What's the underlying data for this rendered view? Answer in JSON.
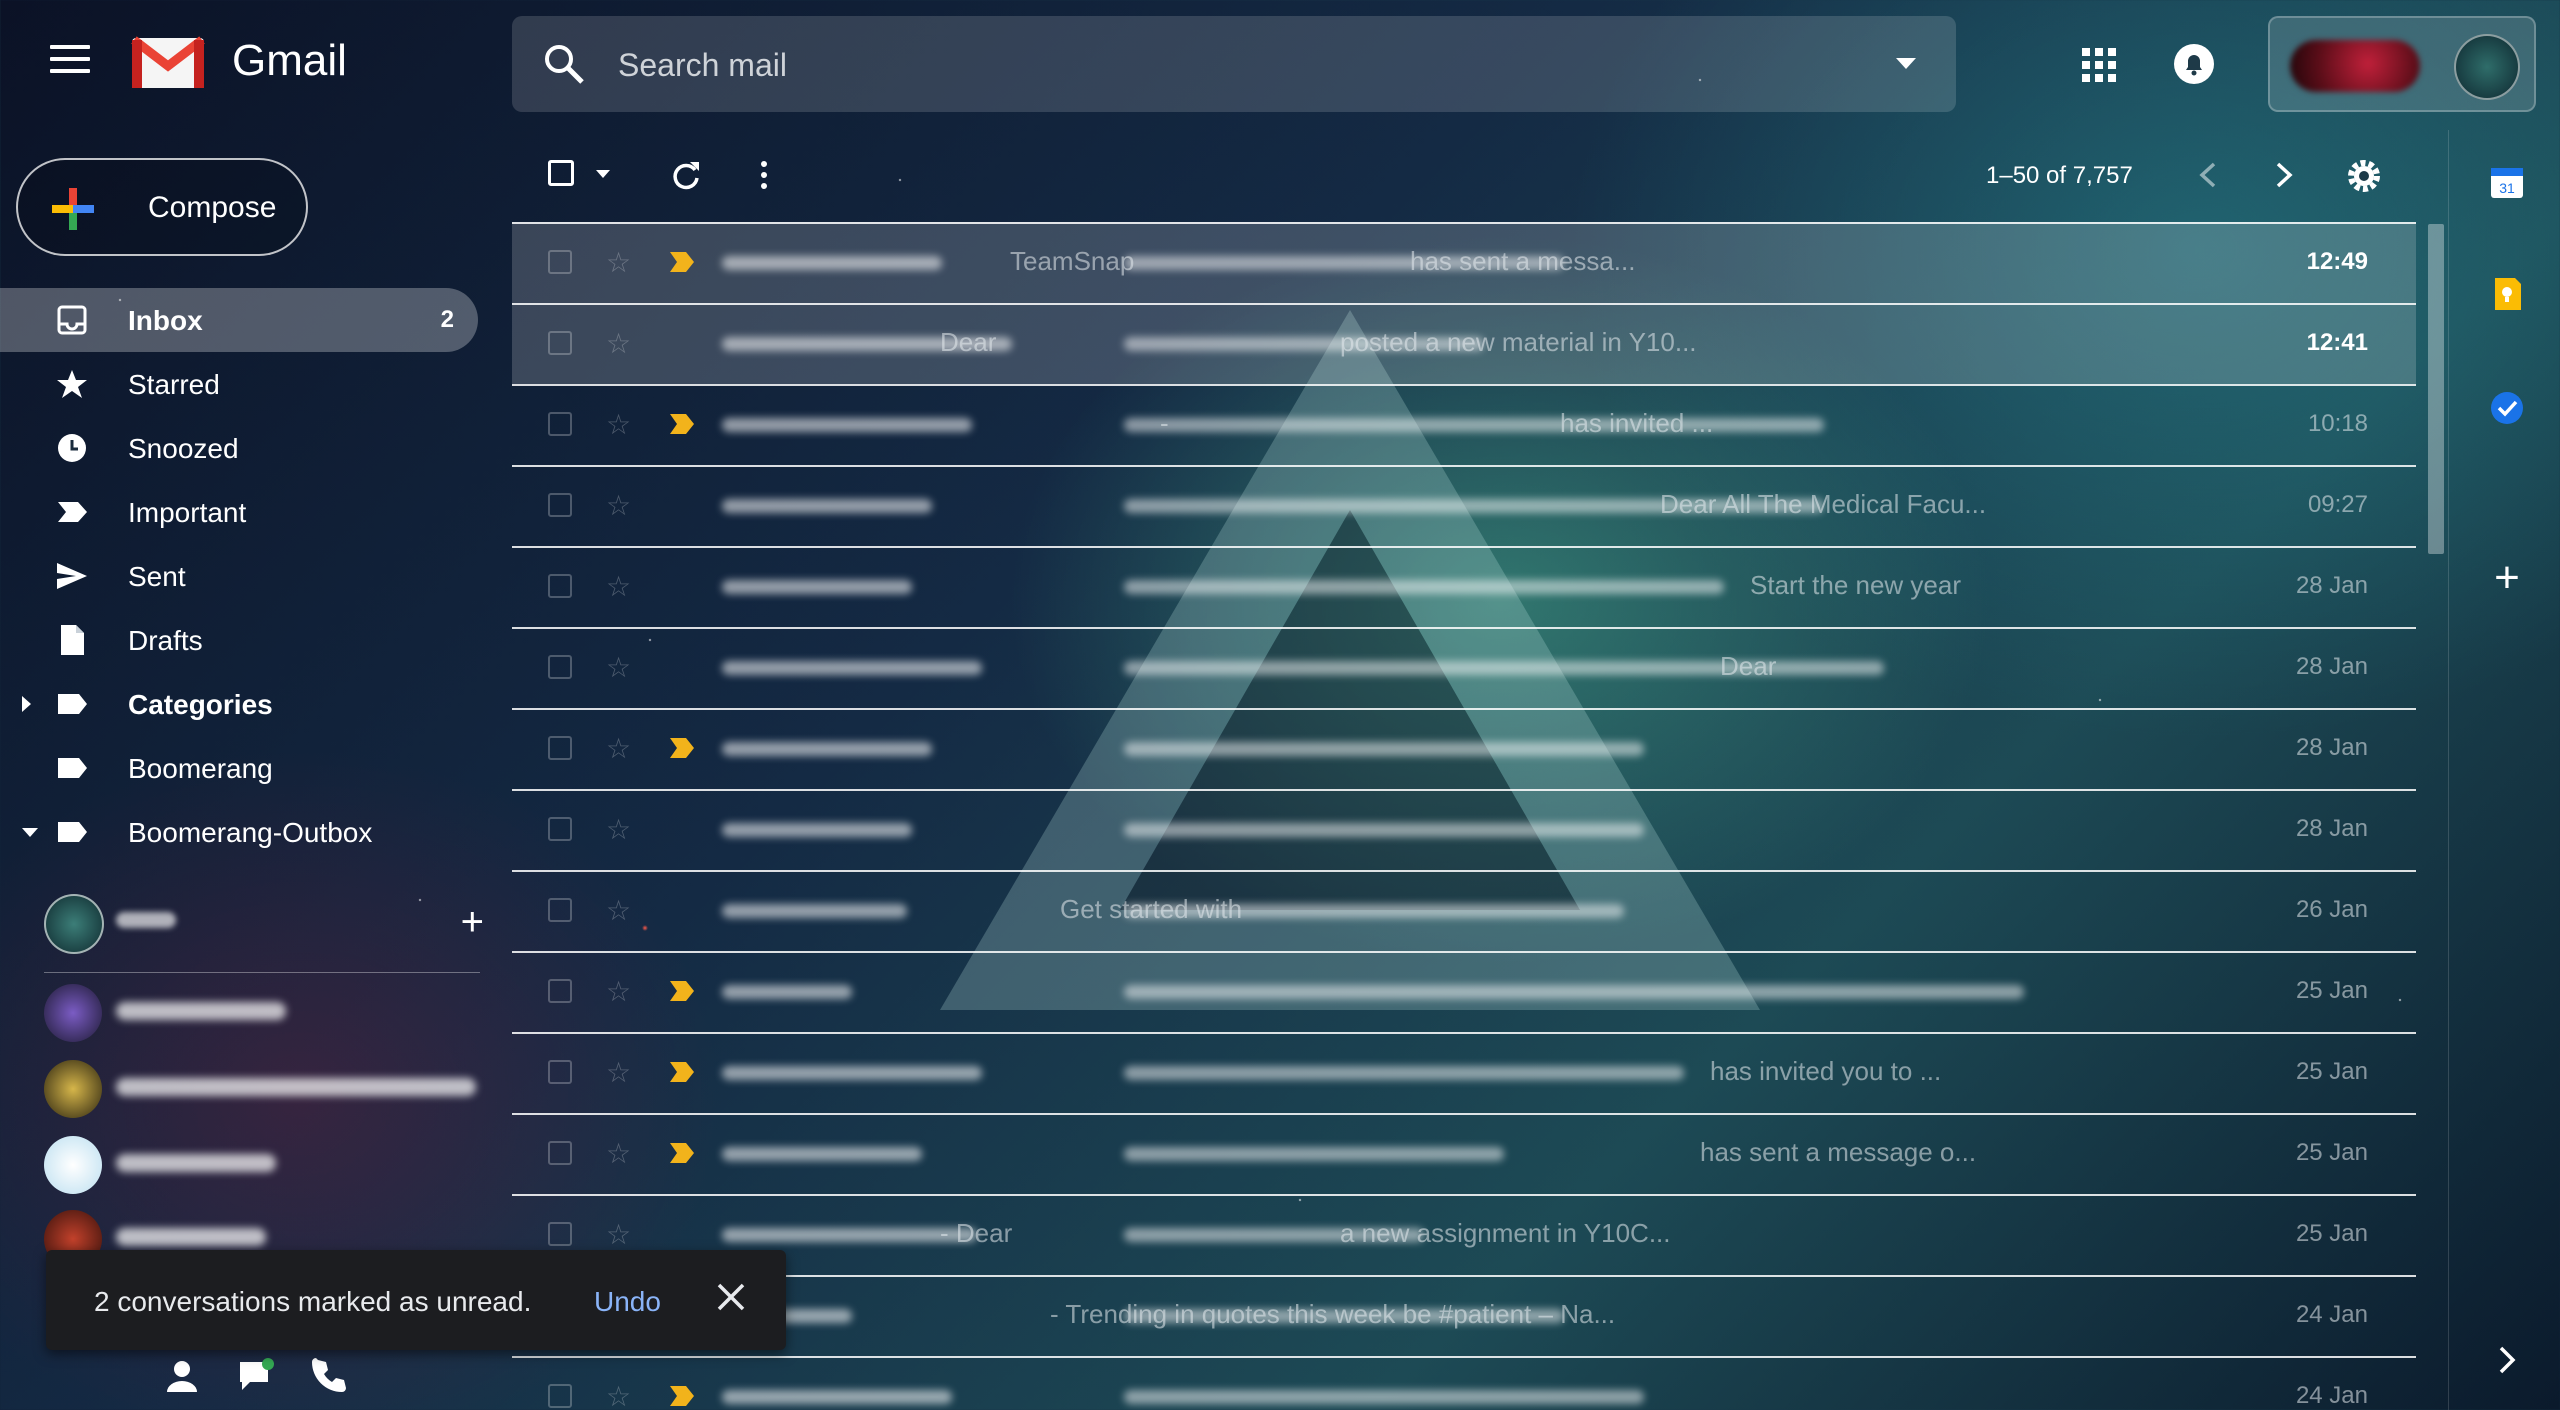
{
  "header": {
    "app_name": "Gmail",
    "search_placeholder": "Search mail"
  },
  "compose": {
    "label": "Compose"
  },
  "nav": [
    {
      "label": "Inbox",
      "count": "2",
      "icon": "inbox-icon",
      "active": true
    },
    {
      "label": "Starred",
      "count": "",
      "icon": "star-icon"
    },
    {
      "label": "Snoozed",
      "count": "",
      "icon": "clock-icon"
    },
    {
      "label": "Important",
      "count": "",
      "icon": "important-icon"
    },
    {
      "label": "Sent",
      "count": "",
      "icon": "send-icon"
    },
    {
      "label": "Drafts",
      "count": "",
      "icon": "draft-icon"
    },
    {
      "label": "Categories",
      "count": "",
      "icon": "label-icon"
    },
    {
      "label": "Boomerang",
      "count": "",
      "icon": "label-icon"
    },
    {
      "label": "Boomerang-Outbox",
      "count": "",
      "icon": "label-icon"
    }
  ],
  "toolbar": {
    "pager_text": "1–50 of 7,757"
  },
  "emails": [
    {
      "snippet": "TeamSnap",
      "snippet2": "has sent a messa...",
      "date": "12:49",
      "unread": true,
      "important": true
    },
    {
      "snippet": "Dear",
      "snippet2": "posted a new material in Y10...",
      "date": "12:41",
      "unread": true,
      "important": false
    },
    {
      "snippet": "-",
      "snippet2": "has invited ...",
      "date": "10:18",
      "unread": false,
      "important": true
    },
    {
      "snippet": "",
      "snippet2": "Dear All The Medical Facu...",
      "date": "09:27",
      "unread": false,
      "important": false
    },
    {
      "snippet": "",
      "snippet2": "Start the new year",
      "date": "28 Jan",
      "unread": false,
      "important": false
    },
    {
      "snippet": "",
      "snippet2": "Dear",
      "date": "28 Jan",
      "unread": false,
      "important": false
    },
    {
      "snippet": "",
      "snippet2": "",
      "date": "28 Jan",
      "unread": false,
      "important": true
    },
    {
      "snippet": "",
      "snippet2": "",
      "date": "28 Jan",
      "unread": false,
      "important": false
    },
    {
      "snippet": "Get started with",
      "snippet2": "",
      "date": "26 Jan",
      "unread": false,
      "important": false
    },
    {
      "snippet": "",
      "snippet2": "",
      "date": "25 Jan",
      "unread": false,
      "important": true
    },
    {
      "snippet": "",
      "snippet2": "has invited you to ...",
      "date": "25 Jan",
      "unread": false,
      "important": true
    },
    {
      "snippet": "",
      "snippet2": "has sent a message o...",
      "date": "25 Jan",
      "unread": false,
      "important": true
    },
    {
      "snippet": "- Dear",
      "snippet2": "a new assignment in Y10C...",
      "date": "25 Jan",
      "unread": false,
      "important": false
    },
    {
      "snippet": "- Trending in quotes this week be #patient – Na...",
      "snippet2": "",
      "date": "24 Jan",
      "unread": false,
      "important": false
    },
    {
      "snippet": "",
      "snippet2": "",
      "date": "24 Jan",
      "unread": false,
      "important": true
    }
  ],
  "toast": {
    "message": "2 conversations marked as unread.",
    "action": "Undo"
  },
  "right_panel": {
    "calendar_day": "31"
  },
  "colors": {
    "important_marker": "#f2b31b",
    "link": "#8ab4f8",
    "toast_bg": "#1c1d20"
  }
}
